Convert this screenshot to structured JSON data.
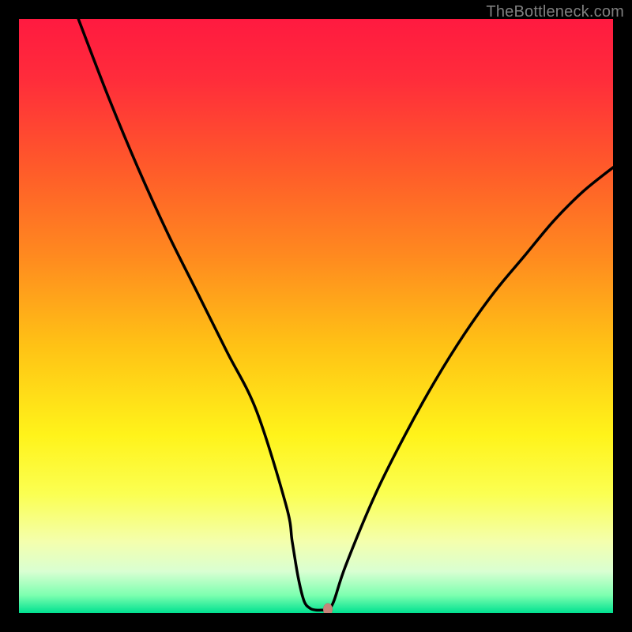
{
  "watermark": "TheBottleneck.com",
  "chart_data": {
    "type": "line",
    "title": "",
    "xlabel": "",
    "ylabel": "",
    "xlim": [
      0,
      100
    ],
    "ylim": [
      0,
      100
    ],
    "grid": false,
    "legend": false,
    "gradient_stops": [
      {
        "offset": 0.0,
        "color": "#ff1a40"
      },
      {
        "offset": 0.1,
        "color": "#ff2c3b"
      },
      {
        "offset": 0.25,
        "color": "#ff5a2a"
      },
      {
        "offset": 0.4,
        "color": "#ff8a1f"
      },
      {
        "offset": 0.55,
        "color": "#ffc215"
      },
      {
        "offset": 0.7,
        "color": "#fff31a"
      },
      {
        "offset": 0.8,
        "color": "#fbff52"
      },
      {
        "offset": 0.88,
        "color": "#f4ffad"
      },
      {
        "offset": 0.93,
        "color": "#d9ffd2"
      },
      {
        "offset": 0.97,
        "color": "#7dffb0"
      },
      {
        "offset": 1.0,
        "color": "#00e190"
      }
    ],
    "series": [
      {
        "name": "bottleneck-curve",
        "x": [
          10,
          15,
          20,
          25,
          30,
          35,
          40,
          45,
          46,
          47,
          48,
          49,
          50,
          51,
          52,
          53,
          55,
          60,
          65,
          70,
          75,
          80,
          85,
          90,
          95,
          100
        ],
        "y": [
          100,
          87,
          75,
          64,
          54,
          44,
          34,
          18,
          12,
          6,
          2,
          0.8,
          0.5,
          0.5,
          0.6,
          2,
          8,
          20,
          30,
          39,
          47,
          54,
          60,
          66,
          71,
          75
        ]
      }
    ],
    "marker": {
      "x": 52,
      "y": 0.6,
      "color": "#c8847a",
      "rx": 6,
      "ry": 8
    }
  }
}
